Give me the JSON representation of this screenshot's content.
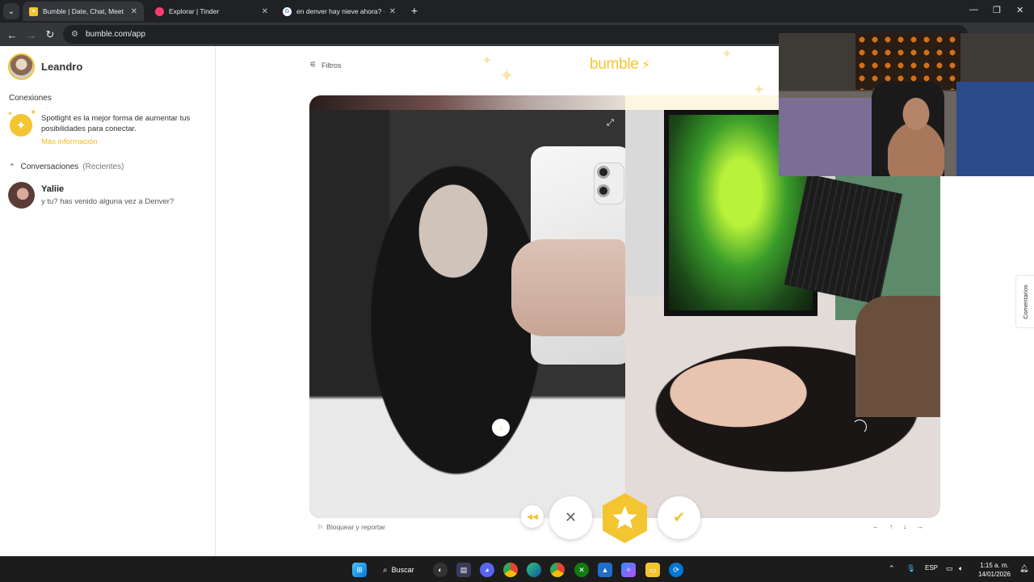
{
  "browser": {
    "tabs": [
      {
        "title": "Bumble | Date, Chat, Meet New",
        "favicon": "bumble-icon",
        "color": "#f3c531",
        "active": true
      },
      {
        "title": "Explorar | Tinder",
        "favicon": "tinder-icon",
        "color": "#fd3a73",
        "active": false
      },
      {
        "title": "en denver hay nieve ahora? - B",
        "favicon": "google-icon",
        "color": "#4285f4",
        "active": false
      }
    ],
    "url": "bumble.com/app"
  },
  "sidebar": {
    "user_name": "Leandro",
    "connections_label": "Conexiones",
    "spotlight_text": "Spotlight es la mejor forma de aumentar tus posibilidades para conectar.",
    "spotlight_link": "Más información",
    "conversations_label": "Conversaciones",
    "conversations_filter": "(Recientes)",
    "conversations": [
      {
        "name": "Yaliie",
        "last_message": "y tu? has venido alguna vez a Denver?"
      }
    ]
  },
  "main": {
    "filters_label": "Filtros",
    "logo_text": "bumble",
    "block_report_label": "Bloquear y reportar",
    "keyboard_hints": [
      "←",
      "↑",
      "↓",
      "→"
    ],
    "comments_tab_label": "Comentarios",
    "accent_color": "#f3c531"
  },
  "taskbar": {
    "search_label": "Buscar",
    "language": "ESP",
    "time": "1:15 a. m.",
    "date": "14/01/2026"
  }
}
